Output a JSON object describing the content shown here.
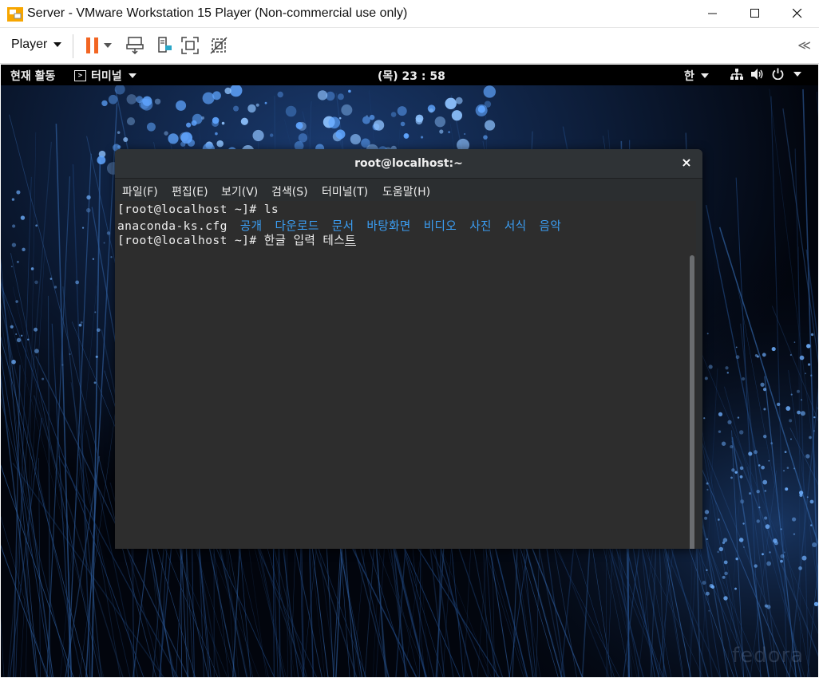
{
  "window": {
    "title": "Server - VMware Workstation 15 Player (Non-commercial use only)",
    "controls": [
      "minimize",
      "maximize",
      "close"
    ]
  },
  "toolbar": {
    "player_label": "Player",
    "collapse_glyph": "≪",
    "icons": [
      "pause-icon",
      "send-ctrl-alt-del-icon",
      "removable-devices-icon",
      "fullscreen-icon",
      "unity-icon"
    ],
    "accent_color": "#f26522"
  },
  "gnome": {
    "activities": "현재 활동",
    "app_menu": "터미널",
    "clock": "(목) 23 : 58",
    "input_method": "한"
  },
  "terminal": {
    "title": "root@localhost:~",
    "close_glyph": "×",
    "menu": [
      "파일(F)",
      "편집(E)",
      "보기(V)",
      "검색(S)",
      "터미널(T)",
      "도움말(H)"
    ],
    "lines": {
      "line1": "[root@localhost ~]# ls",
      "file1": "anaconda-ks.cfg",
      "dirs": [
        "공개",
        "다운로드",
        "문서",
        "바탕화면",
        "비디오",
        "사진",
        "서식",
        "음악"
      ],
      "prompt2": "[root@localhost ~]# ",
      "input_text": "한글 입력 테스",
      "input_cursor_char": "트"
    },
    "dir_color": "#3b9ff5"
  },
  "wallpaper": {
    "watermark": "fedora"
  }
}
